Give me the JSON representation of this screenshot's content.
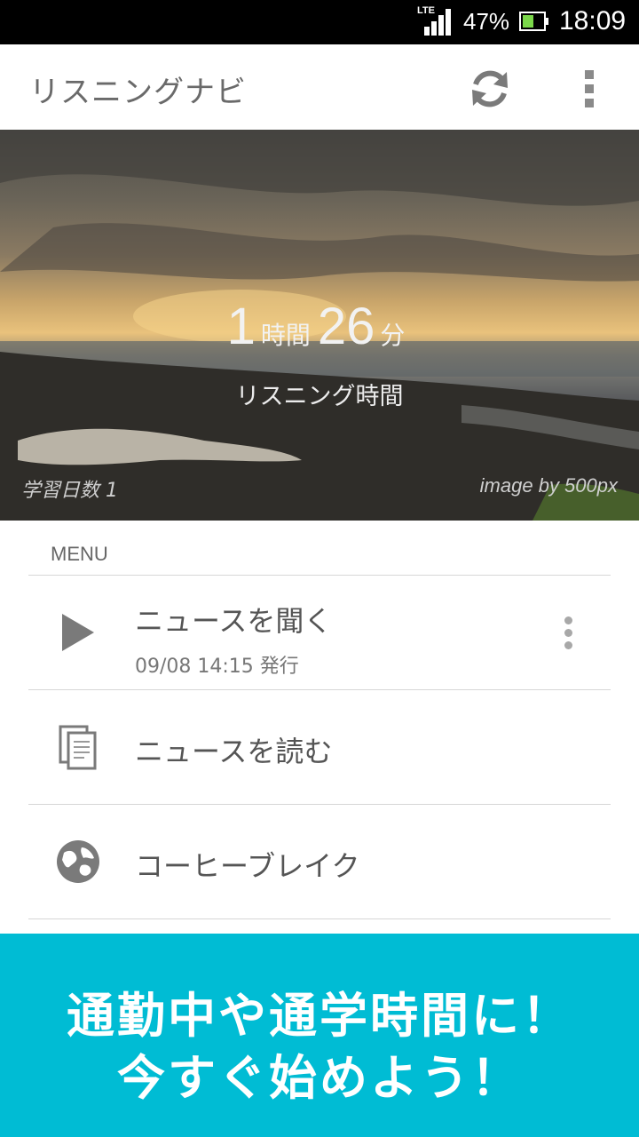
{
  "status_bar": {
    "network": "LTE",
    "battery_percent": "47%",
    "battery_level": 0.47,
    "time": "18:09"
  },
  "app_bar": {
    "title": "リスニングナビ",
    "refresh_icon": "refresh-icon",
    "overflow_icon": "overflow-menu-icon"
  },
  "hero": {
    "hours": "1",
    "hours_unit": "時間",
    "minutes": "26",
    "minutes_unit": "分",
    "caption": "リスニング時間",
    "study_days": "学習日数 1",
    "credit": "image by 500px"
  },
  "menu": {
    "header": "MENU",
    "items": [
      {
        "label": "ニュースを聞く",
        "sub": "09/08 14:15 発行",
        "icon": "play-icon",
        "more_icon": "more-vert-icon"
      },
      {
        "label": "ニュースを読む",
        "icon": "documents-icon"
      },
      {
        "label": "コーヒーブレイク",
        "icon": "globe-icon"
      }
    ]
  },
  "banner": {
    "line1": "通勤中や通学時間に！",
    "line2": "今すぐ始めよう！",
    "color": "#00bcd4"
  }
}
